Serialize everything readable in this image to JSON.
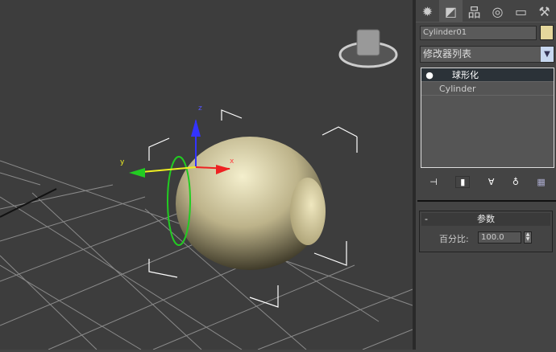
{
  "viewport": {
    "axes": {
      "x": "x",
      "y": "y",
      "z": "z"
    }
  },
  "command_panel": {
    "tabs": [
      {
        "icon": "create-icon",
        "glyph": "✹"
      },
      {
        "icon": "modify-icon",
        "glyph": "◩"
      },
      {
        "icon": "hierarchy-icon",
        "glyph": "品"
      },
      {
        "icon": "motion-icon",
        "glyph": "◎"
      },
      {
        "icon": "display-icon",
        "glyph": "▭"
      },
      {
        "icon": "utilities-icon",
        "glyph": "⚒"
      }
    ],
    "object_name": "Cylinder01",
    "object_color": "#e5d79c",
    "modifier_list": "修改器列表",
    "stack": [
      {
        "label": "球形化",
        "selected": true
      },
      {
        "label": "Cylinder",
        "selected": false
      }
    ],
    "rollout": {
      "title": "参数",
      "collapse": "-",
      "param_label": "百分比:",
      "param_value": "100.0"
    }
  }
}
